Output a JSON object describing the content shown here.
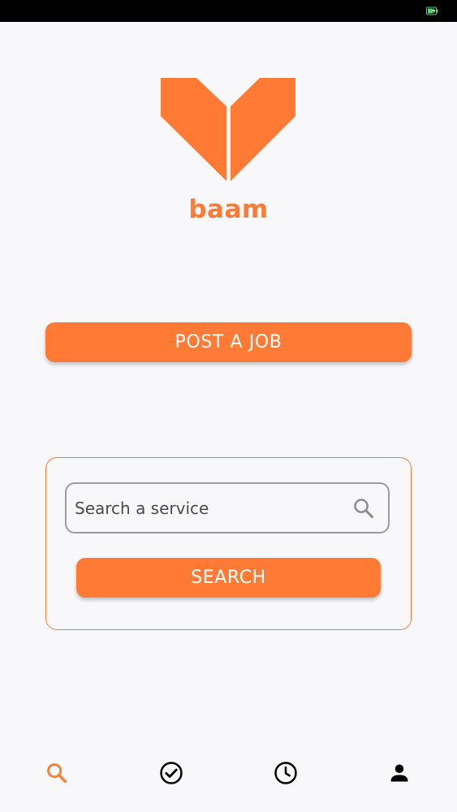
{
  "app": {
    "brand_name": "baam",
    "accent_color": "#ff7a34"
  },
  "status_bar": {
    "battery_icon": "battery-charging-icon",
    "battery_color": "#4cd964"
  },
  "main": {
    "post_job_label": "POST A JOB",
    "search": {
      "placeholder": "Search a service",
      "value": "",
      "icon": "search-icon",
      "button_label": "SEARCH"
    }
  },
  "bottom_nav": {
    "items": [
      {
        "id": "search",
        "icon": "search-icon",
        "active": true
      },
      {
        "id": "jobs",
        "icon": "check-circle-icon",
        "active": false
      },
      {
        "id": "history",
        "icon": "clock-icon",
        "active": false
      },
      {
        "id": "profile",
        "icon": "person-icon",
        "active": false
      }
    ],
    "active_color": "#ff7a34",
    "inactive_color": "#000000"
  }
}
